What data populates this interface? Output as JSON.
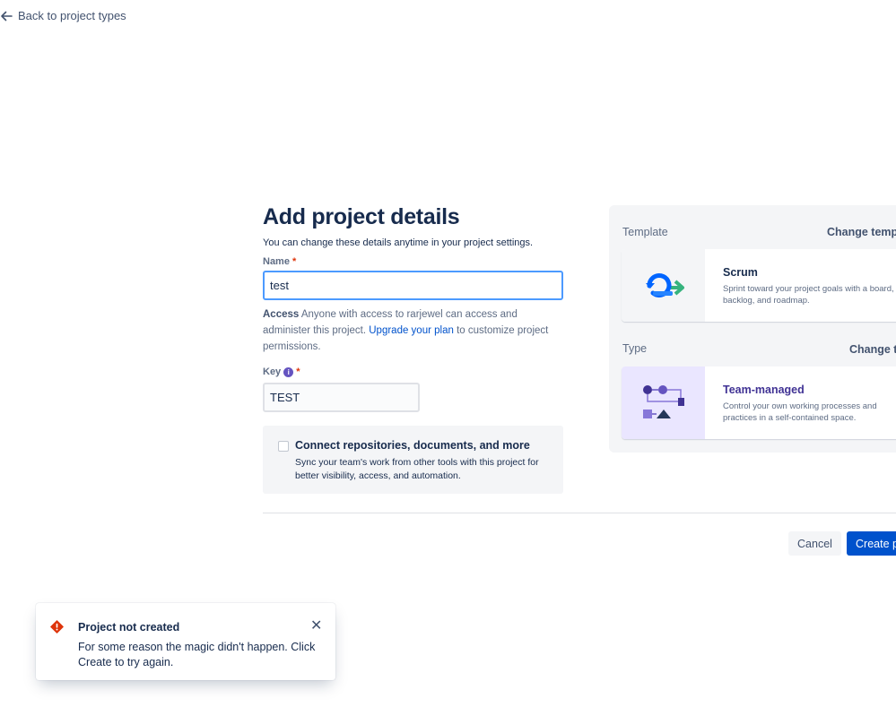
{
  "nav": {
    "back_label": "Back to project types"
  },
  "form": {
    "title": "Add project details",
    "subtitle": "You can change these details anytime in your project settings.",
    "name_label": "Name",
    "required_mark": "*",
    "name_value": "test",
    "access_label": "Access",
    "access_text_1": "Anyone with access to rarjewel can access and administer this project.",
    "access_link": "Upgrade your plan",
    "access_text_2": "to customize project permissions.",
    "key_label": "Key",
    "key_info_glyph": "i",
    "key_value": "TEST",
    "connect_title": "Connect repositories, documents, and more",
    "connect_desc": "Sync your team's work from other tools with this project for better visibility, access, and automation."
  },
  "actions": {
    "cancel_label": "Cancel",
    "create_label": "Create project"
  },
  "panel": {
    "template_label": "Template",
    "template_change": "Change template",
    "template_card": {
      "title": "Scrum",
      "desc_line1": "Sprint toward your project goals with a board,",
      "desc_line2": "backlog, and roadmap."
    },
    "type_label": "Type",
    "type_change": "Change type",
    "type_card": {
      "title": "Team-managed",
      "desc_line1": "Control your own working processes and",
      "desc_line2": "practices in a self-contained space."
    }
  },
  "toast": {
    "title": "Project not created",
    "message": "For some reason the magic didn't happen. Click Create to try again.",
    "close_glyph": "✕"
  },
  "colors": {
    "primary": "#0052cc",
    "focus_border": "#4c9aff",
    "error": "#de350b",
    "discovery": "#6554c0",
    "team_card_bg": "#eae6ff",
    "scrum_card_bg": "#f4f5f7"
  }
}
